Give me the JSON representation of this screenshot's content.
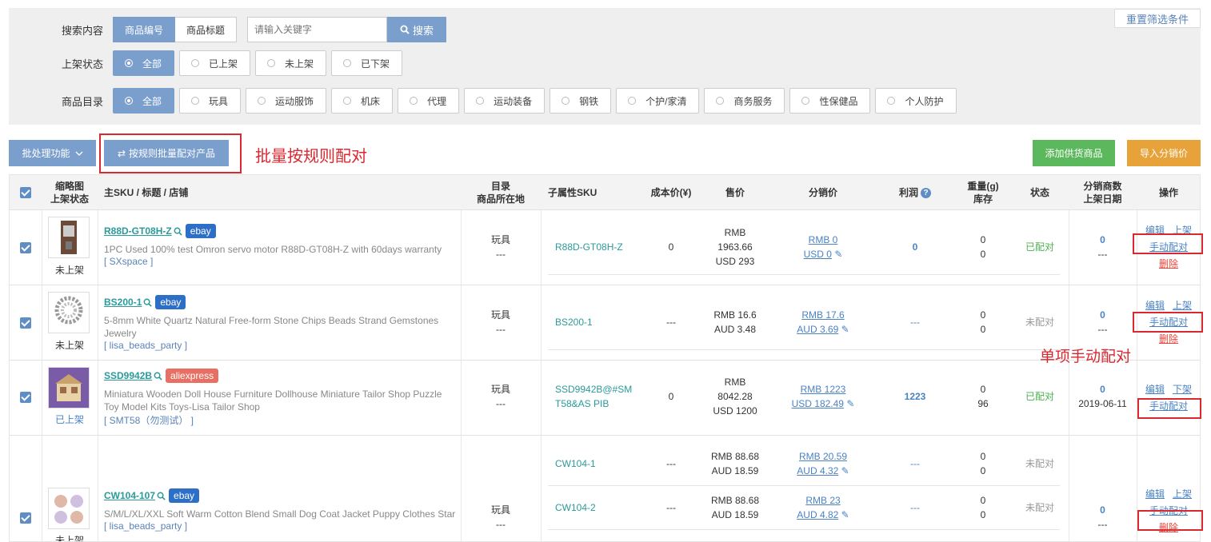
{
  "filters": {
    "search_label": "搜索内容",
    "search_types": [
      "商品编号",
      "商品标题"
    ],
    "search_placeholder": "请输入关键字",
    "search_button": "搜索",
    "reset_button": "重置筛选条件",
    "status_label": "上架状态",
    "status_options": [
      "全部",
      "已上架",
      "未上架",
      "已下架"
    ],
    "category_label": "商品目录",
    "category_options": [
      "全部",
      "玩具",
      "运动服饰",
      "机床",
      "代理",
      "运动装备",
      "钢铁",
      "个护/家清",
      "商务服务",
      "性保健品",
      "个人防护"
    ]
  },
  "toolbar": {
    "batch_label": "批处理功能",
    "rule_match_label": "按规则批量配对产品",
    "add_supplier_label": "添加供货商品",
    "import_label": "导入分销价"
  },
  "annotations": {
    "batch": "批量按规则配对",
    "single": "单项手动配对"
  },
  "colors": {
    "primary": "#7b9fcd",
    "green_button": "#5cb85c",
    "orange_button": "#e8a23a",
    "annotation_red": "#d9282f"
  },
  "table": {
    "headers": {
      "thumb": [
        "缩略图",
        "上架状态"
      ],
      "main": "主SKU / 标题 / 店铺",
      "catalog": [
        "目录",
        "商品所在地"
      ],
      "sub_sku": "子属性SKU",
      "cost": "成本价(¥)",
      "price": "售价",
      "dist_price": "分销价",
      "profit": "利润",
      "weight": [
        "重量(g)",
        "库存"
      ],
      "status": "状态",
      "dist_count": [
        "分销商数",
        "上架日期"
      ],
      "ops": "操作"
    },
    "rows": [
      {
        "sku": "R88D-GT08H-Z",
        "platform": "ebay",
        "list_status": "未上架",
        "title": "1PC Used 100% test Omron servo motor R88D-GT08H-Z with 60days warranty",
        "store": "[ SXspace ]",
        "catalog": "玩具",
        "location": "---",
        "variants": [
          {
            "sub_sku": "R88D-GT08H-Z",
            "cost": "0",
            "price": [
              "RMB",
              "1963.66",
              "USD 293"
            ],
            "dist": [
              "RMB 0",
              "USD 0"
            ],
            "profit": "0",
            "weight": "0",
            "stock": "0",
            "status": "已配对"
          }
        ],
        "dist_count": "0",
        "date": "---",
        "ops": [
          "编辑",
          "上架",
          "手动配对",
          "删除"
        ]
      },
      {
        "sku": "BS200-1",
        "platform": "ebay",
        "list_status": "未上架",
        "title": "5-8mm White Quartz Natural Free-form Stone Chips Beads Strand Gemstones Jewelry",
        "store": "[ lisa_beads_party ]",
        "catalog": "玩具",
        "location": "---",
        "variants": [
          {
            "sub_sku": "BS200-1",
            "cost": "---",
            "price": [
              "RMB 16.6",
              "AUD 3.48"
            ],
            "dist": [
              "RMB 17.6",
              "AUD 3.69"
            ],
            "profit": "---",
            "weight": "0",
            "stock": "0",
            "status": "未配对"
          }
        ],
        "dist_count": "0",
        "date": "---",
        "ops": [
          "编辑",
          "上架",
          "手动配对",
          "删除"
        ]
      },
      {
        "sku": "SSD9942B",
        "platform": "aliexpress",
        "list_status": "已上架",
        "title": "Miniatura Wooden Doll House Furniture Dollhouse Miniature Tailor Shop Puzzle Toy Model Kits Toys-Lisa Tailor Shop",
        "store": "[ SMT58（勿测试） ]",
        "catalog": "玩具",
        "location": "---",
        "variants": [
          {
            "sub_sku": "SSD9942B@#SMT58&AS PIB",
            "cost": "0",
            "price": [
              "RMB",
              "8042.28",
              "USD 1200"
            ],
            "dist": [
              "RMB 1223",
              "USD 182.49"
            ],
            "profit": "1223",
            "weight": "0",
            "stock": "96",
            "status": "已配对"
          }
        ],
        "dist_count": "0",
        "date": "2019-06-11",
        "ops": [
          "编辑",
          "下架",
          "手动配对"
        ]
      },
      {
        "sku": "CW104-107",
        "platform": "ebay",
        "list_status": "未上架",
        "title": "S/M/L/XL/XXL Soft Warm Cotton Blend Small Dog Coat Jacket Puppy Clothes Star",
        "store": "[ lisa_beads_party ]",
        "catalog": "玩具",
        "location": "---",
        "variants": [
          {
            "sub_sku": "CW104-1",
            "cost": "---",
            "price": [
              "RMB 88.68",
              "AUD 18.59"
            ],
            "dist": [
              "RMB 20.59",
              "AUD 4.32"
            ],
            "profit": "---",
            "weight": "0",
            "stock": "0",
            "status": "未配对"
          },
          {
            "sub_sku": "CW104-2",
            "cost": "---",
            "price": [
              "RMB 88.68",
              "AUD 18.59"
            ],
            "dist": [
              "RMB 23",
              "AUD 4.82"
            ],
            "profit": "---",
            "weight": "0",
            "stock": "0",
            "status": "未配对"
          }
        ],
        "dist_count": "0",
        "date": "---",
        "ops": [
          "编辑",
          "上架",
          "手动配对",
          "删除"
        ]
      }
    ]
  }
}
